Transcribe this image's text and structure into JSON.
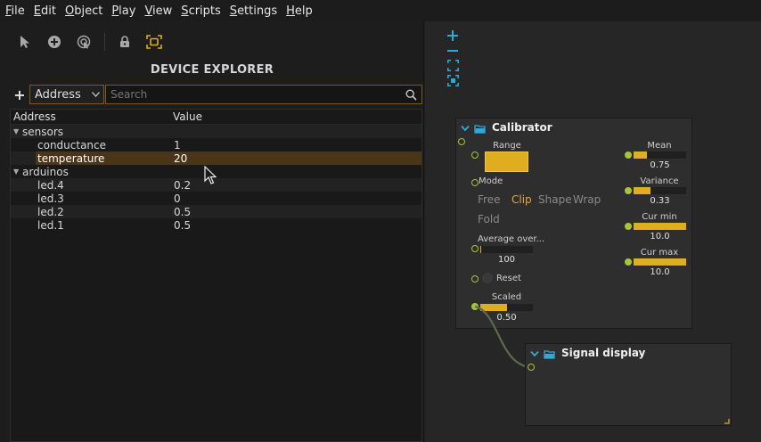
{
  "menu": [
    {
      "u": "F",
      "rest": "ile"
    },
    {
      "u": "E",
      "rest": "dit"
    },
    {
      "u": "O",
      "rest": "bject"
    },
    {
      "u": "P",
      "rest": "lay"
    },
    {
      "u": "V",
      "rest": "iew"
    },
    {
      "u": "S",
      "rest": "cripts"
    },
    {
      "u": "S",
      "rest": "ettings"
    },
    {
      "u": "H",
      "rest": "elp"
    }
  ],
  "toolbar_icons": [
    "select-arrow-icon",
    "add-circle-icon",
    "play-cursor-icon",
    "lock-icon",
    "fit-selection-icon"
  ],
  "explorer": {
    "title": "DEVICE EXPLORER",
    "add_label": "+",
    "protocol_select": "Address",
    "search_placeholder": "Search",
    "columns": {
      "address": "Address",
      "value": "Value"
    },
    "devices": [
      {
        "name": "sensors",
        "children": [
          {
            "name": "conductance",
            "value": "1"
          },
          {
            "name": "temperature",
            "value": "20",
            "selected": true
          }
        ]
      },
      {
        "name": "arduinos",
        "children": [
          {
            "name": "led.4",
            "value": "0.2"
          },
          {
            "name": "led.3",
            "value": "0"
          },
          {
            "name": "led.2",
            "value": "0.5"
          },
          {
            "name": "led.1",
            "value": "0.5"
          }
        ]
      }
    ]
  },
  "colors": {
    "accent": "#e0ad20",
    "selection": "#4a3518",
    "port": "#a7c43a",
    "zoom": "#2fa9d6"
  },
  "calibrator": {
    "title": "Calibrator",
    "range_label": "Range",
    "mode_label": "Mode",
    "modes": [
      "Free",
      "Clip",
      "Shape",
      "Wrap",
      "Fold"
    ],
    "active_mode": "Clip",
    "average_label": "Average over...",
    "average_value": "100",
    "average_fraction": 0.02,
    "reset_label": "Reset",
    "scaled_label": "Scaled",
    "scaled_value": "0.50",
    "scaled_fraction": 0.5,
    "outputs": [
      {
        "label": "Mean",
        "value": "0.75",
        "fraction": 0.25
      },
      {
        "label": "Variance",
        "value": "0.33",
        "fraction": 0.33
      },
      {
        "label": "Cur min",
        "value": "10.0",
        "fraction": 1.0
      },
      {
        "label": "Cur max",
        "value": "10.0",
        "fraction": 1.0
      }
    ]
  },
  "signal_display": {
    "title": "Signal display"
  }
}
